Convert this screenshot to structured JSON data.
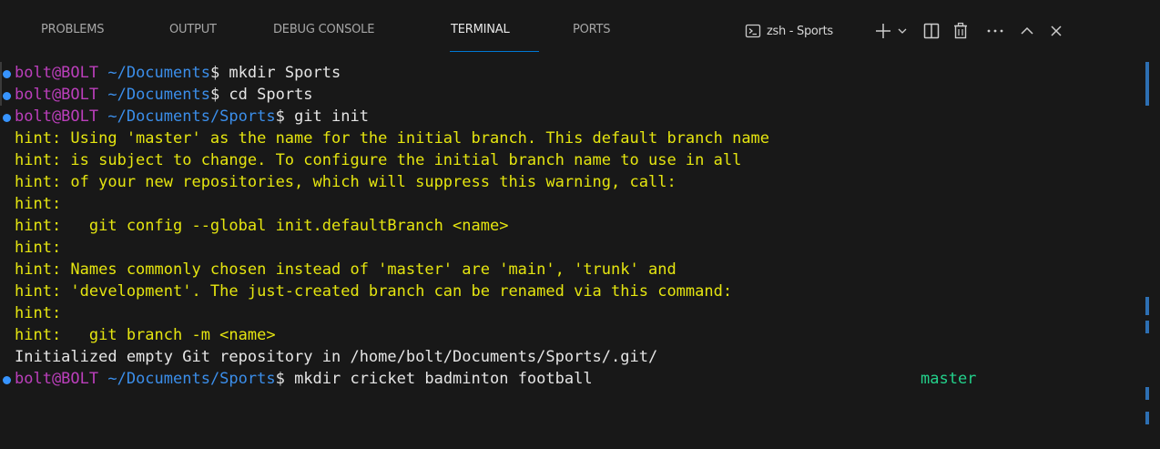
{
  "tabs": [
    {
      "label": "PROBLEMS",
      "active": false
    },
    {
      "label": "OUTPUT",
      "active": false
    },
    {
      "label": "DEBUG CONSOLE",
      "active": false
    },
    {
      "label": "TERMINAL",
      "active": true
    },
    {
      "label": "PORTS",
      "active": false
    }
  ],
  "terminal_selector": {
    "label": "zsh - Sports",
    "icon": "terminal-icon"
  },
  "header_actions": [
    {
      "name": "new-terminal-icon"
    },
    {
      "name": "chevron-down-icon"
    },
    {
      "name": "split-terminal-icon"
    },
    {
      "name": "trash-icon"
    },
    {
      "name": "more-actions-icon"
    },
    {
      "name": "chevron-up-icon"
    },
    {
      "name": "close-icon"
    }
  ],
  "colors": {
    "background": "#181818",
    "active_tab_underline": "#0078d4",
    "prompt_user": "#bc3fbc",
    "prompt_path": "#3b8eea",
    "hint_text": "#e5e510",
    "branch": "#23d18b",
    "command_dot": "#3794ff"
  },
  "terminal": {
    "prompt_user": "bolt@BOLT",
    "lines": [
      {
        "kind": "cmd",
        "path": " ~/Documents",
        "cmd": "$ mkdir Sports"
      },
      {
        "kind": "cmd",
        "path": " ~/Documents",
        "cmd": "$ cd Sports"
      },
      {
        "kind": "cmd",
        "path": " ~/Documents/Sports",
        "cmd": "$ git init"
      },
      {
        "kind": "hint",
        "text": "hint: Using 'master' as the name for the initial branch. This default branch name"
      },
      {
        "kind": "hint",
        "text": "hint: is subject to change. To configure the initial branch name to use in all"
      },
      {
        "kind": "hint",
        "text": "hint: of your new repositories, which will suppress this warning, call:"
      },
      {
        "kind": "hint",
        "text": "hint:"
      },
      {
        "kind": "hint",
        "text": "hint:   git config --global init.defaultBranch <name>"
      },
      {
        "kind": "hint",
        "text": "hint:"
      },
      {
        "kind": "hint",
        "text": "hint: Names commonly chosen instead of 'master' are 'main', 'trunk' and"
      },
      {
        "kind": "hint",
        "text": "hint: 'development'. The just-created branch can be renamed via this command:"
      },
      {
        "kind": "hint",
        "text": "hint:"
      },
      {
        "kind": "hint",
        "text": "hint:   git branch -m <name>"
      },
      {
        "kind": "output",
        "text": "Initialized empty Git repository in /home/bolt/Documents/Sports/.git/"
      },
      {
        "kind": "cmd",
        "path": " ~/Documents/Sports",
        "cmd": "$ mkdir cricket badminton football",
        "branch": "master"
      }
    ]
  }
}
